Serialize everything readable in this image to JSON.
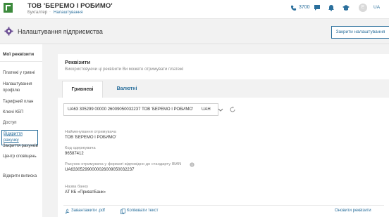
{
  "header": {
    "company_name": "ТОВ 'БЕРЕМО І РОБИМО'",
    "company_caret": "▾",
    "role": "Бухгалтер",
    "role_separator": "·",
    "settings_link": "Налаштування",
    "phone": "3700",
    "avatar_letter": "E",
    "language": "UA",
    "accent_color": "#2a6f9c",
    "logo_color": "#3c8a3c",
    "icons": [
      "phone-icon",
      "chat-icon",
      "bell-icon",
      "graduation-cap-icon",
      "avatar",
      "language-switch"
    ]
  },
  "titlebar": {
    "title": "Налаштування підприємства",
    "close_button": "Закрити налаштування"
  },
  "sidebar": {
    "title": "Мої реквізити",
    "items": [
      {
        "label": "Платежі у гривні",
        "active": false
      },
      {
        "label": "Налаштування профілю",
        "active": false
      },
      {
        "label": "Тарифний план",
        "active": false
      },
      {
        "label": "Ключі КЕП",
        "active": false
      },
      {
        "label": "Доступ",
        "active": false
      },
      {
        "label": "Відкриття рахунку",
        "active": true
      },
      {
        "label": "Закриття рахунків",
        "active": false
      },
      {
        "label": "Центр сповіщень",
        "active": false
      },
      {
        "label": "Відкрити виписка",
        "active": false
      }
    ]
  },
  "card": {
    "title": "Реквізити",
    "subtitle": "Використовуючи ці реквізити Ви можете отримувати платежі",
    "tabs": [
      {
        "label": "Гривневі",
        "active": true
      },
      {
        "label": "Валютні",
        "active": false
      }
    ],
    "account": {
      "number": "UA63 305299 00000 26009050032237 ТОВ 'БЕРЕМО І РОБИМО'",
      "currency": "UAH"
    },
    "fields": [
      {
        "label": "Найменування отримувача",
        "value": "ТОВ 'БЕРЕМО І РОБИМО'"
      },
      {
        "label": "Код одержувача",
        "value": "96587412"
      },
      {
        "label": "Рахунок отримувача у форматі відповідно до стандарту IBAN",
        "value": "UA633052990000026009050032237"
      },
      {
        "label": "Назва банку",
        "value": "АТ КБ «ПриватБанк»"
      }
    ],
    "actions": {
      "download_pdf": "Завантажити .pdf",
      "copy_text": "Копіювати текст",
      "update": "Оновити реквізити"
    }
  }
}
